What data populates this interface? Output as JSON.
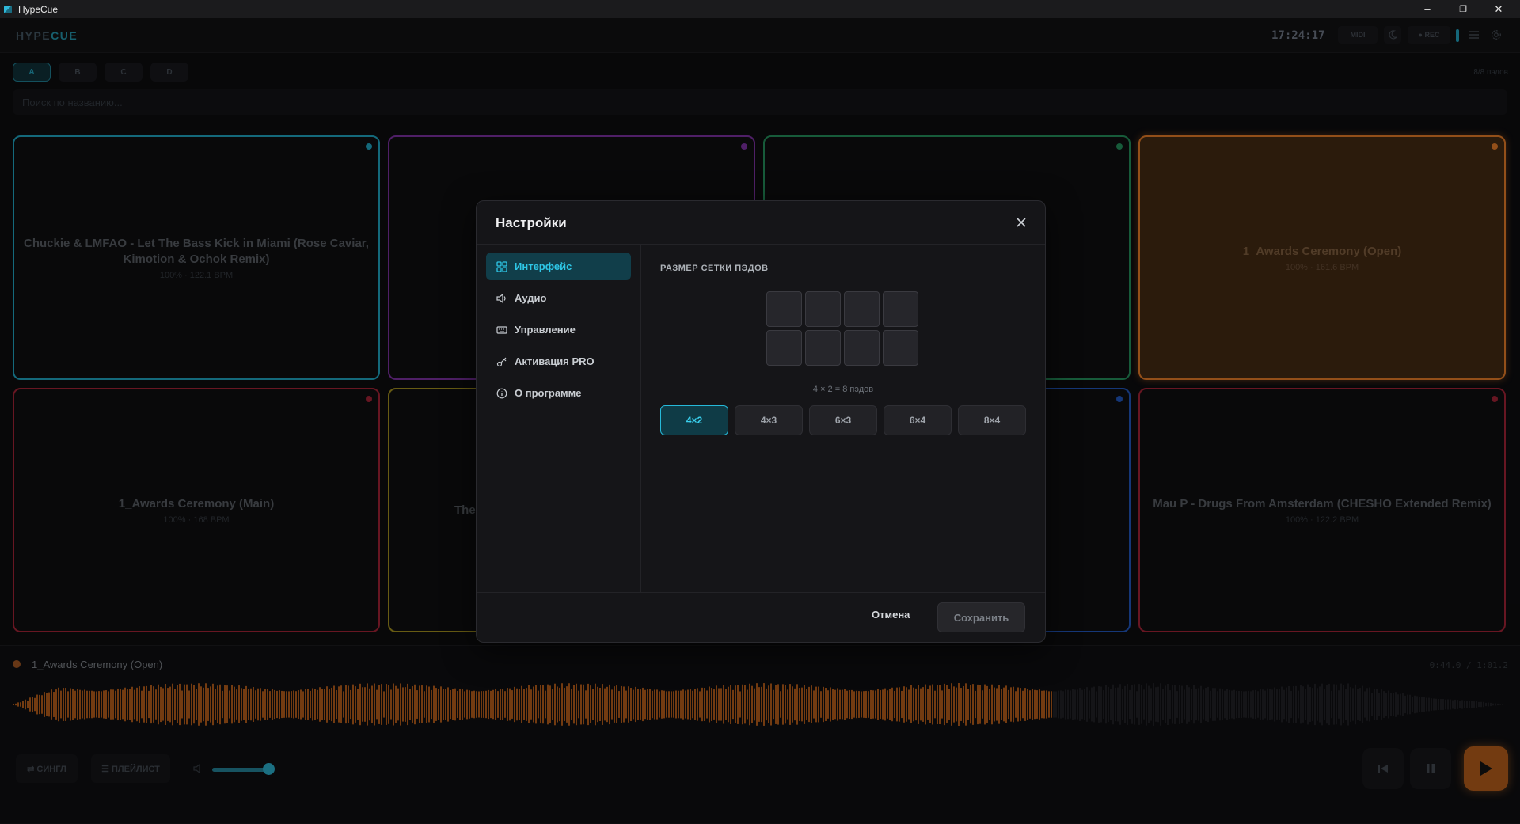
{
  "window": {
    "title": "HypeCue",
    "minimize": "–",
    "restore": "❐",
    "close": "✕"
  },
  "header": {
    "brand_prefix": "HYPE",
    "brand_accent": "CUE",
    "clock": "17:24:17",
    "midi_label": "MIDI",
    "rec_label": "● REC"
  },
  "banks": [
    "A",
    "B",
    "C",
    "D"
  ],
  "active_bank": "A",
  "pads_count": "8/8 пэдов",
  "search": {
    "placeholder": "Поиск по названию..."
  },
  "pads": [
    {
      "title": "Chuckie & LMFAO - Let The Bass Kick in Miami (Rose Caviar, Kimotion & Ochok Remix)",
      "meta": "100% · 122.1 BPM",
      "color": "#1b8da5"
    },
    {
      "title": "",
      "meta": "",
      "color": "#6a2a8a"
    },
    {
      "title": "",
      "meta": "",
      "color": "#1f7a4e"
    },
    {
      "title": "1_Awards Ceremony (Open)",
      "meta": "100% · 161.6 BPM",
      "color": "#c46a22"
    },
    {
      "title": "1_Awards Ceremony (Main)",
      "meta": "100% · 168 BPM",
      "color": "#8a1e2e"
    },
    {
      "title": "The",
      "meta": "",
      "color": "#8a7a1a"
    },
    {
      "title": "",
      "meta": "",
      "color": "#1d4aa0"
    },
    {
      "title": "Mau P - Drugs From Amsterdam (CHESHO Extended Remix)",
      "meta": "100% · 122.2 BPM",
      "color": "#8a1e2e"
    }
  ],
  "player": {
    "now_playing": "1_Awards Ceremony (Open)",
    "time": "0:44.0 / 1:01.2",
    "progress": 0.72,
    "mode_single": "⇄ СИНГЛ",
    "mode_playlist": "☰ ПЛЕЙЛИСТ",
    "volume": 0.9,
    "accent_color": "#c46a22"
  },
  "modal": {
    "title": "Настройки",
    "nav": [
      {
        "label": "Интерфейс",
        "icon": "grid-icon",
        "active": true
      },
      {
        "label": "Аудио",
        "icon": "speaker-icon",
        "active": false
      },
      {
        "label": "Управление",
        "icon": "keyboard-icon",
        "active": false
      },
      {
        "label": "Активация PRO",
        "icon": "key-icon",
        "active": false
      },
      {
        "label": "О программе",
        "icon": "info-icon",
        "active": false
      }
    ],
    "section_label": "РАЗМЕР СЕТКИ ПЭДОВ",
    "grid_caption": "4 × 2 = 8 пэдов",
    "grid_cols": 4,
    "grid_rows": 2,
    "sizes": [
      "4×2",
      "4×3",
      "6×3",
      "6×4",
      "8×4"
    ],
    "selected_size": "4×2",
    "cancel_label": "Отмена",
    "save_label": "Сохранить",
    "accent_color": "#26b9d9"
  }
}
